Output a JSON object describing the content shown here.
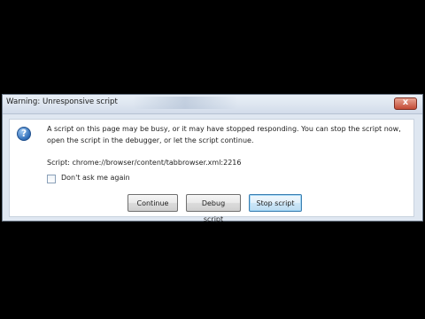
{
  "dialog": {
    "title": "Warning: Unresponsive script",
    "close_glyph": "x",
    "icon": "question-icon",
    "icon_glyph": "?",
    "message_line1": "A script on this page may be busy, or it may have stopped responding. You can stop the script now,",
    "message_line2": "open the script in the debugger, or let the script continue.",
    "script_line": "Script: chrome://browser/content/tabbrowser.xml:2216",
    "checkbox_label": "Don't ask me again",
    "checkbox_checked": false,
    "buttons": {
      "continue": "Continue",
      "debug": "Debug script",
      "stop": "Stop script"
    }
  },
  "colors": {
    "background": "#000000",
    "dialog_frame": "#dfe7f1",
    "close_button": "#c24a35",
    "focused_button_border": "#3c7fb1"
  }
}
